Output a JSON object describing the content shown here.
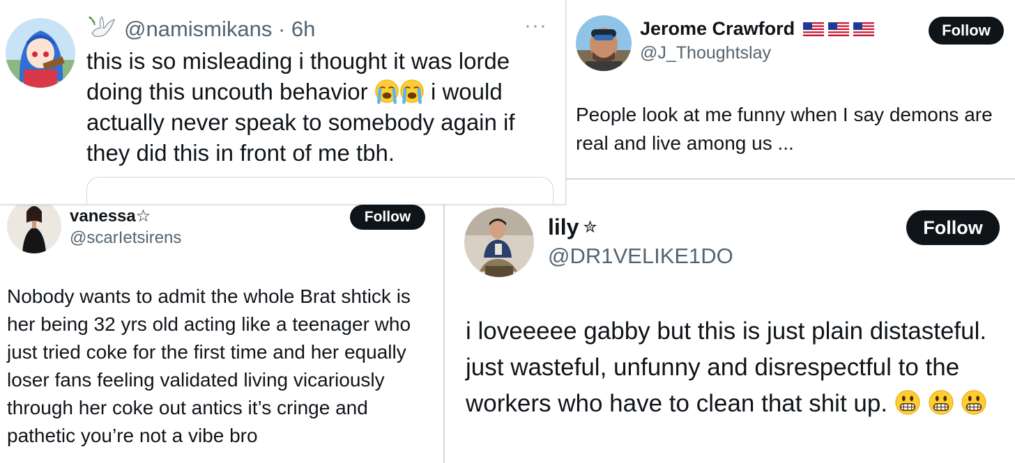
{
  "tweets": [
    {
      "handle": "@namismikans",
      "time": "· 6h",
      "more": "···",
      "text_before": "this is so misleading i thought it was lorde doing this uncouth behavior",
      "emoji_1": "loudly-crying-face",
      "emoji_2": "loudly-crying-face",
      "text_after": "i would actually never speak to somebody again if they did this in front of me tbh."
    },
    {
      "name": "Jerome Crawford",
      "flags": [
        "us-flag",
        "us-flag",
        "us-flag"
      ],
      "handle": "@J_Thoughtslay",
      "follow": "Follow",
      "text": "People look at me funny when I say demons are real and live among us ..."
    },
    {
      "name": "vanessa☆",
      "handle": "@scarIetsirens",
      "follow": "Follow",
      "text": "Nobody wants to admit the whole Brat shtick is her being 32 yrs old acting like a teenager who just tried coke for the first time and her equally loser fans feeling validated living vicariously through her coke out antics it’s cringe and pathetic you’re not a vibe bro"
    },
    {
      "name": "lily",
      "name_symbol": "✮",
      "handle": "@DR1VELIKE1DO",
      "follow": "Follow",
      "text": "i loveeeee gabby but this is just plain distasteful. just wasteful, unfunny and disrespectful to the workers who have to clean that shit up.",
      "emojis": [
        "grimacing-face",
        "grimacing-face",
        "grimacing-face"
      ]
    }
  ],
  "colors": {
    "text": "#0f1419",
    "secondary": "#536471",
    "follow_bg": "#0f1419",
    "follow_text": "#ffffff",
    "border": "#cfd9de"
  }
}
